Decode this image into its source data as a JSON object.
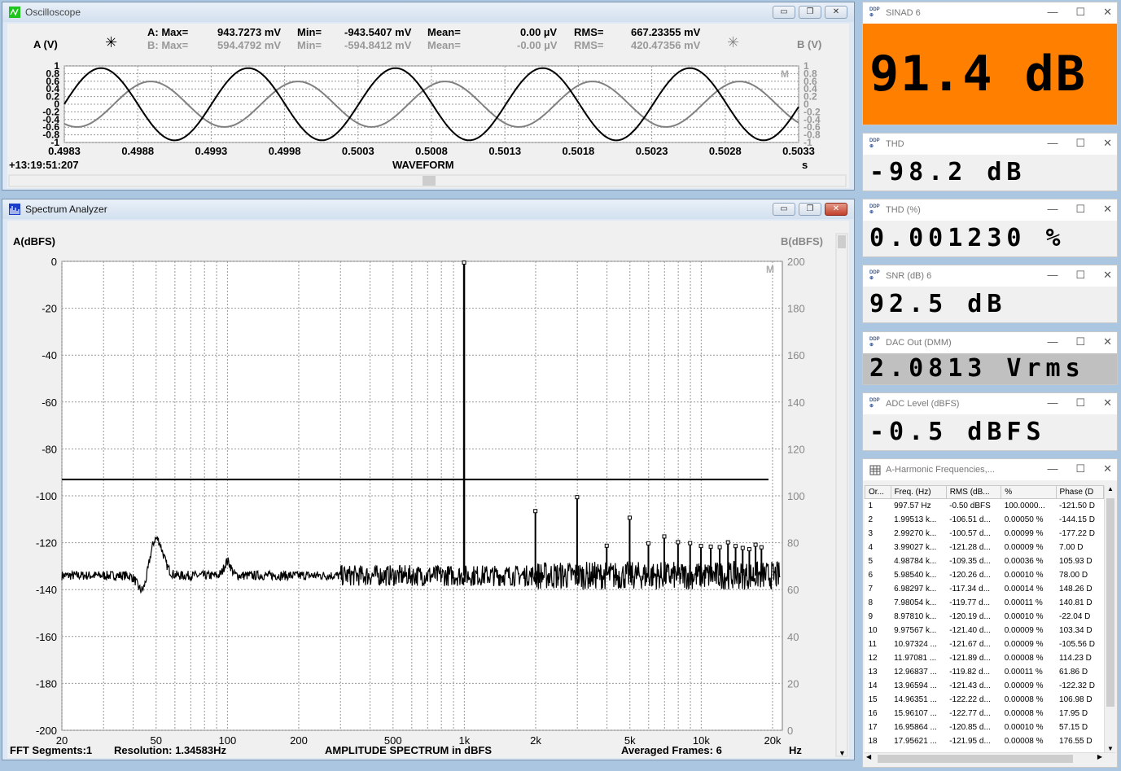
{
  "osc": {
    "title": "Oscilloscope",
    "ylabel_a": "A (V)",
    "ylabel_b": "B (V)",
    "row_a": {
      "label": "A: Max=",
      "max": "943.7273 mV",
      "min_label": "Min=",
      "min": "-943.5407 mV",
      "mean_label": "Mean=",
      "mean": "0.00  µV",
      "rms_label": "RMS=",
      "rms": "667.23355 mV"
    },
    "row_b": {
      "label": "B: Max=",
      "max": "594.4792 mV",
      "min_label": "Min=",
      "min": "-594.8412 mV",
      "mean_label": "Mean=",
      "mean": "-0.00  µV",
      "rms_label": "RMS=",
      "rms": "420.47356 mV"
    },
    "timestamp": "+13:19:51:207",
    "xlabel": "WAVEFORM",
    "xunit": "s",
    "corner_mark": "M",
    "y_ticks": [
      "1",
      "0.8",
      "0.6",
      "0.4",
      "0.2",
      "0",
      "-0.2",
      "-0.4",
      "-0.6",
      "-0.8",
      "-1"
    ],
    "x_ticks": [
      "0.4983",
      "0.4988",
      "0.4993",
      "0.4998",
      "0.5003",
      "0.5008",
      "0.5013",
      "0.5018",
      "0.5023",
      "0.5028",
      "0.5033"
    ]
  },
  "spec": {
    "title": "Spectrum Analyzer",
    "ylabel_a": "A(dBFS)",
    "ylabel_b": "B(dBFS)",
    "corner_mark": "M",
    "left_ticks": [
      "0",
      "-20",
      "-40",
      "-60",
      "-80",
      "-100",
      "-120",
      "-140",
      "-160",
      "-180",
      "-200"
    ],
    "right_ticks": [
      "200",
      "180",
      "160",
      "140",
      "120",
      "100",
      "80",
      "60",
      "40",
      "20",
      "0"
    ],
    "x_ticks": [
      "20",
      "50",
      "100",
      "200",
      "500",
      "1k",
      "2k",
      "5k",
      "10k",
      "20k"
    ],
    "x_unit": "Hz",
    "footer_segments": "FFT Segments:1",
    "footer_resolution": "Resolution: 1.34583Hz",
    "footer_title": "AMPLITUDE SPECTRUM in dBFS",
    "footer_frames": "Averaged Frames: 6"
  },
  "chart_data": [
    {
      "type": "line",
      "title": "WAVEFORM",
      "xlabel": "s",
      "ylabel": "A (V)",
      "xlim": [
        0.4983,
        0.5033
      ],
      "ylim": [
        -1,
        1
      ],
      "grid": true,
      "series": [
        {
          "name": "A",
          "amplitude": 0.9437,
          "frequency_hz": 997.57,
          "color": "#000000"
        },
        {
          "name": "B",
          "amplitude": 0.5946,
          "frequency_hz": 997.57,
          "color": "#808080"
        }
      ]
    },
    {
      "type": "line",
      "title": "AMPLITUDE SPECTRUM in dBFS",
      "xlabel": "Hz",
      "ylabel": "A(dBFS)",
      "x_scale": "log",
      "xlim": [
        20,
        22000
      ],
      "ylim": [
        -200,
        0
      ],
      "grid": true,
      "threshold_line_dbfs": -93,
      "harmonics": [
        {
          "order": 1,
          "freq_hz": 997.57,
          "dbfs": -0.5
        },
        {
          "order": 2,
          "freq_hz": 1995.13,
          "dbfs": -106.51
        },
        {
          "order": 3,
          "freq_hz": 2992.7,
          "dbfs": -100.57
        },
        {
          "order": 4,
          "freq_hz": 3990.27,
          "dbfs": -121.28
        },
        {
          "order": 5,
          "freq_hz": 4987.84,
          "dbfs": -109.35
        },
        {
          "order": 6,
          "freq_hz": 5985.4,
          "dbfs": -120.26
        },
        {
          "order": 7,
          "freq_hz": 6982.97,
          "dbfs": -117.34
        },
        {
          "order": 8,
          "freq_hz": 7980.54,
          "dbfs": -119.77
        },
        {
          "order": 9,
          "freq_hz": 8978.1,
          "dbfs": -120.19
        },
        {
          "order": 10,
          "freq_hz": 9975.67,
          "dbfs": -121.4
        },
        {
          "order": 11,
          "freq_hz": 10973.24,
          "dbfs": -121.67
        },
        {
          "order": 12,
          "freq_hz": 11970.81,
          "dbfs": -121.89
        },
        {
          "order": 13,
          "freq_hz": 12968.37,
          "dbfs": -119.82
        },
        {
          "order": 14,
          "freq_hz": 13965.94,
          "dbfs": -121.43
        },
        {
          "order": 15,
          "freq_hz": 14963.51,
          "dbfs": -122.22
        },
        {
          "order": 16,
          "freq_hz": 15961.07,
          "dbfs": -122.77
        },
        {
          "order": 17,
          "freq_hz": 16958.64,
          "dbfs": -120.85
        },
        {
          "order": 18,
          "freq_hz": 17956.21,
          "dbfs": -121.95
        }
      ],
      "noise_floor_dbfs": -134
    }
  ],
  "meters": [
    {
      "title": "SINAD  6",
      "value": "91.4 dB",
      "bg": "#ff7f00"
    },
    {
      "title": "THD",
      "value": "-98.2 dB",
      "bg": "#f0f0f0"
    },
    {
      "title": "THD (%)",
      "value": "0.001230 %",
      "bg": "#f0f0f0"
    },
    {
      "title": "SNR (dB)  6",
      "value": "92.5 dB",
      "bg": "#f0f0f0"
    },
    {
      "title": "DAC Out (DMM)",
      "value": "2.0813 Vrms",
      "bg": "#c0c0c0"
    },
    {
      "title": "ADC Level (dBFS)",
      "value": "-0.5 dBFS",
      "bg": "#f0f0f0"
    }
  ],
  "harm": {
    "title": "A-Harmonic Frequencies,...",
    "headers": [
      "Or...",
      "Freq. (Hz)",
      "RMS (dB...",
      "%",
      "Phase (D"
    ],
    "rows": [
      [
        "1",
        "997.57 Hz",
        "-0.50 dBFS",
        "100.0000...",
        "-121.50  D"
      ],
      [
        "2",
        "1.99513 k...",
        "-106.51 d...",
        "0.00050  %",
        "-144.15  D"
      ],
      [
        "3",
        "2.99270 k...",
        "-100.57 d...",
        "0.00099  %",
        "-177.22  D"
      ],
      [
        "4",
        "3.99027 k...",
        "-121.28 d...",
        "0.00009  %",
        "7.00  D"
      ],
      [
        "5",
        "4.98784 k...",
        "-109.35 d...",
        "0.00036  %",
        "105.93  D"
      ],
      [
        "6",
        "5.98540 k...",
        "-120.26 d...",
        "0.00010  %",
        "78.00  D"
      ],
      [
        "7",
        "6.98297 k...",
        "-117.34 d...",
        "0.00014  %",
        "148.26  D"
      ],
      [
        "8",
        "7.98054 k...",
        "-119.77 d...",
        "0.00011  %",
        "140.81  D"
      ],
      [
        "9",
        "8.97810 k...",
        "-120.19 d...",
        "0.00010  %",
        "-22.04  D"
      ],
      [
        "10",
        "9.97567 k...",
        "-121.40 d...",
        "0.00009  %",
        "103.34  D"
      ],
      [
        "11",
        "10.97324 ...",
        "-121.67 d...",
        "0.00009  %",
        "-105.56  D"
      ],
      [
        "12",
        "11.97081 ...",
        "-121.89 d...",
        "0.00008  %",
        "114.23  D"
      ],
      [
        "13",
        "12.96837 ...",
        "-119.82 d...",
        "0.00011  %",
        "61.86  D"
      ],
      [
        "14",
        "13.96594 ...",
        "-121.43 d...",
        "0.00009  %",
        "-122.32  D"
      ],
      [
        "15",
        "14.96351 ...",
        "-122.22 d...",
        "0.00008  %",
        "106.98  D"
      ],
      [
        "16",
        "15.96107 ...",
        "-122.77 d...",
        "0.00008  %",
        "17.95  D"
      ],
      [
        "17",
        "16.95864 ...",
        "-120.85 d...",
        "0.00010  %",
        "57.15  D"
      ],
      [
        "18",
        "17.95621 ...",
        "-121.95 d...",
        "0.00008  %",
        "176.55  D"
      ]
    ]
  }
}
